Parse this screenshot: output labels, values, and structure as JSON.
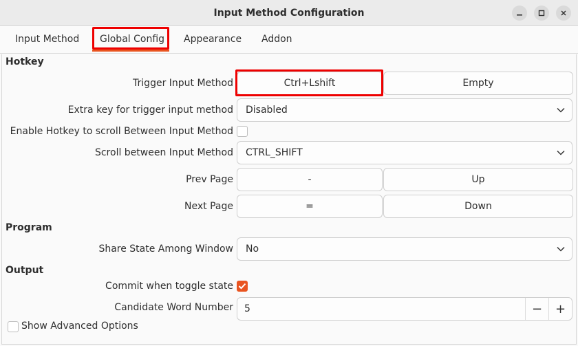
{
  "window": {
    "title": "Input Method Configuration",
    "controls": {
      "minimize": "minimize-icon",
      "maximize": "maximize-icon",
      "close": "close-icon"
    }
  },
  "tabs": [
    {
      "label": "Input Method"
    },
    {
      "label": "Global Config",
      "selected": true
    },
    {
      "label": "Appearance"
    },
    {
      "label": "Addon"
    }
  ],
  "accent_color": "#e95420",
  "highlight_color": "#ee0000",
  "sections": {
    "hotkey": "Hotkey",
    "program": "Program",
    "output": "Output"
  },
  "hotkey": {
    "trigger": {
      "label": "Trigger Input Method",
      "key1": "Ctrl+Lshift",
      "key2": "Empty"
    },
    "extra_key": {
      "label": "Extra key for trigger input method",
      "value": "Disabled"
    },
    "enable_scroll": {
      "label": "Enable Hotkey to scroll Between Input Method",
      "checked": false
    },
    "scroll": {
      "label": "Scroll between Input Method",
      "value": "CTRL_SHIFT"
    },
    "prev_page": {
      "label": "Prev Page",
      "key1": "-",
      "key2": "Up"
    },
    "next_page": {
      "label": "Next Page",
      "key1": "=",
      "key2": "Down"
    }
  },
  "program": {
    "share_state": {
      "label": "Share State Among Window",
      "value": "No"
    }
  },
  "output": {
    "commit_toggle": {
      "label": "Commit when toggle state",
      "checked": true
    },
    "candidate_number": {
      "label": "Candidate Word Number",
      "value": "5",
      "decrement": "−",
      "increment": "+"
    }
  },
  "advanced": {
    "label": "Show Advanced Options",
    "checked": false
  }
}
